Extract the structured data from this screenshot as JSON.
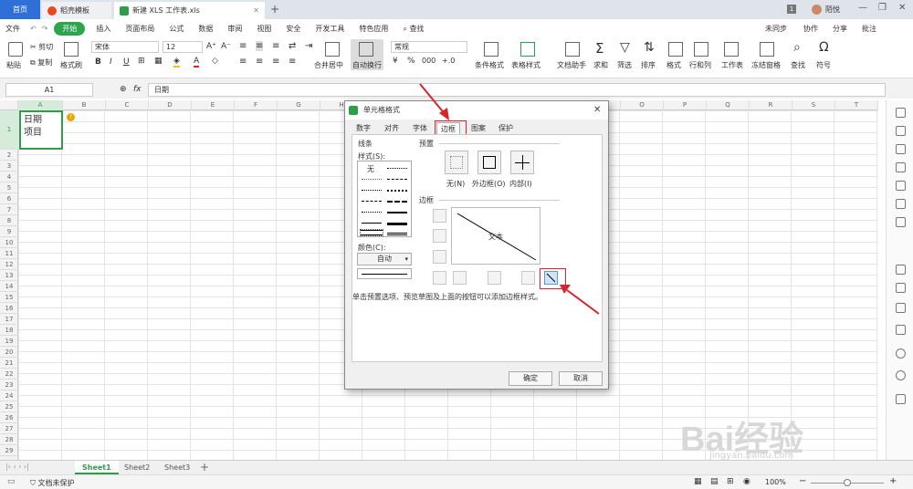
{
  "tabs": {
    "home": "首页",
    "template": "稻壳模板",
    "file": "新建 XLS 工作表.xls",
    "user": "陌悦",
    "page_badge": "1"
  },
  "menu": [
    "文件",
    "开始",
    "插入",
    "页面布局",
    "公式",
    "数据",
    "审阅",
    "视图",
    "安全",
    "开发工具",
    "特色应用"
  ],
  "menu_active": "开始",
  "menu_search": "查找",
  "menu_right": {
    "sync": "未同步",
    "share": "协作",
    "share2": "分享",
    "comment": "批注"
  },
  "toolbar": {
    "paste": "粘贴",
    "cut": "剪切",
    "copy": "复制",
    "format_painter": "格式刷",
    "font": "宋体",
    "size": "12",
    "merge": "合并居中",
    "wrap": "自动换行",
    "number_format": "常规",
    "cond_format": "条件格式",
    "table_style": "表格样式",
    "doc_helper": "文档助手",
    "sum": "求和",
    "filter": "筛选",
    "sort": "排序",
    "format": "格式",
    "rowcol": "行和列",
    "sheet": "工作表",
    "freeze": "冻结窗格",
    "find": "查找",
    "symbol": "符号"
  },
  "formula": {
    "cell_ref": "A1",
    "fx": "fx",
    "content": "日期"
  },
  "columns": [
    "A",
    "B",
    "C",
    "D",
    "E",
    "F",
    "G",
    "H",
    "I",
    "J",
    "K",
    "L",
    "M",
    "N",
    "O",
    "P",
    "Q",
    "R",
    "S",
    "T"
  ],
  "rows": [
    "1",
    "2",
    "3",
    "4",
    "5",
    "6",
    "7",
    "8",
    "9",
    "10",
    "11",
    "12",
    "13",
    "14",
    "15",
    "16",
    "17",
    "18",
    "19",
    "20",
    "21",
    "22",
    "23",
    "24",
    "25",
    "26",
    "27",
    "28",
    "29"
  ],
  "cell_a1": "日期\n项目",
  "sheets": [
    "Sheet1",
    "Sheet2",
    "Sheet3"
  ],
  "status": {
    "protect": "文档未保护",
    "zoom": "100%"
  },
  "dialog": {
    "title": "单元格格式",
    "tabs": [
      "数字",
      "对齐",
      "字体",
      "边框",
      "图案",
      "保护"
    ],
    "active_tab": "边框",
    "line_section": "线条",
    "style_label": "样式(S):",
    "none_style": "无",
    "color_label": "颜色(C):",
    "color_value": "自动",
    "preset_section": "预置",
    "presets": [
      "无(N)",
      "外边框(O)",
      "内部(I)"
    ],
    "border_section": "边框",
    "preview_text": "文本",
    "hint": "单击预置选项、预览草图及上面的按钮可以添加边框样式。",
    "ok": "确定",
    "cancel": "取消"
  },
  "watermark": {
    "brand": "Bai经验",
    "url": "jingyan.baidu.com"
  },
  "colors": {
    "accent_green": "#2e9e4a",
    "home_blue": "#2e6fd8",
    "arrow_red": "#d9232d"
  }
}
